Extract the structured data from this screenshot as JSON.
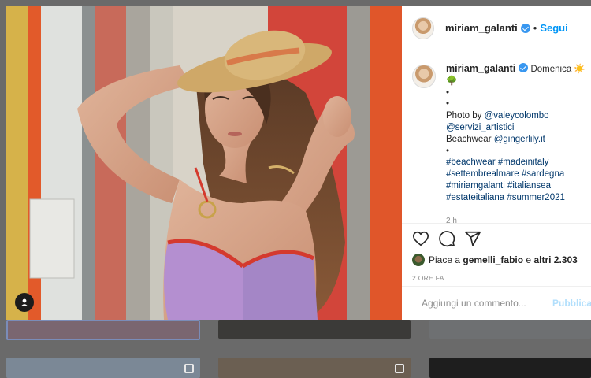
{
  "header": {
    "username": "miriam_galanti",
    "separator": "•",
    "follow_label": "Segui"
  },
  "caption": {
    "username": "miriam_galanti",
    "text_first": "Domenica",
    "emoji": "☀️🌳",
    "dot_lines": [
      "•",
      "•"
    ],
    "photo_by_prefix": "Photo by ",
    "photo_by_handle": "@valeycolombo",
    "styling_handle": "@servizi_artistici",
    "beachwear_prefix": "Beachwear ",
    "beachwear_handle": "@gingerlily.it",
    "dot_line_2": "•",
    "hashtags": [
      "#beachwear",
      "#madeinitaly",
      "#settembrealmare",
      "#sardegna",
      "#miriamgalanti",
      "#italiansea",
      "#estateitaliana",
      "#summer2021"
    ],
    "time_ago": "2 h"
  },
  "actions": {
    "icons": [
      "heart-icon",
      "comment-icon",
      "share-icon"
    ],
    "liked_by_prefix": "Piace a ",
    "liked_by_user": "gemelli_fabio",
    "liked_by_middle": " e ",
    "liked_by_others": "altri 2.303",
    "post_date": "2 ORE FA"
  },
  "comment": {
    "placeholder": "Aggiungi un commento...",
    "publish_label": "Pubblica"
  },
  "colors": {
    "link": "#00376b",
    "follow": "#0095f6",
    "verified": "#3897f0",
    "publish_disabled": "#b2dffc"
  }
}
